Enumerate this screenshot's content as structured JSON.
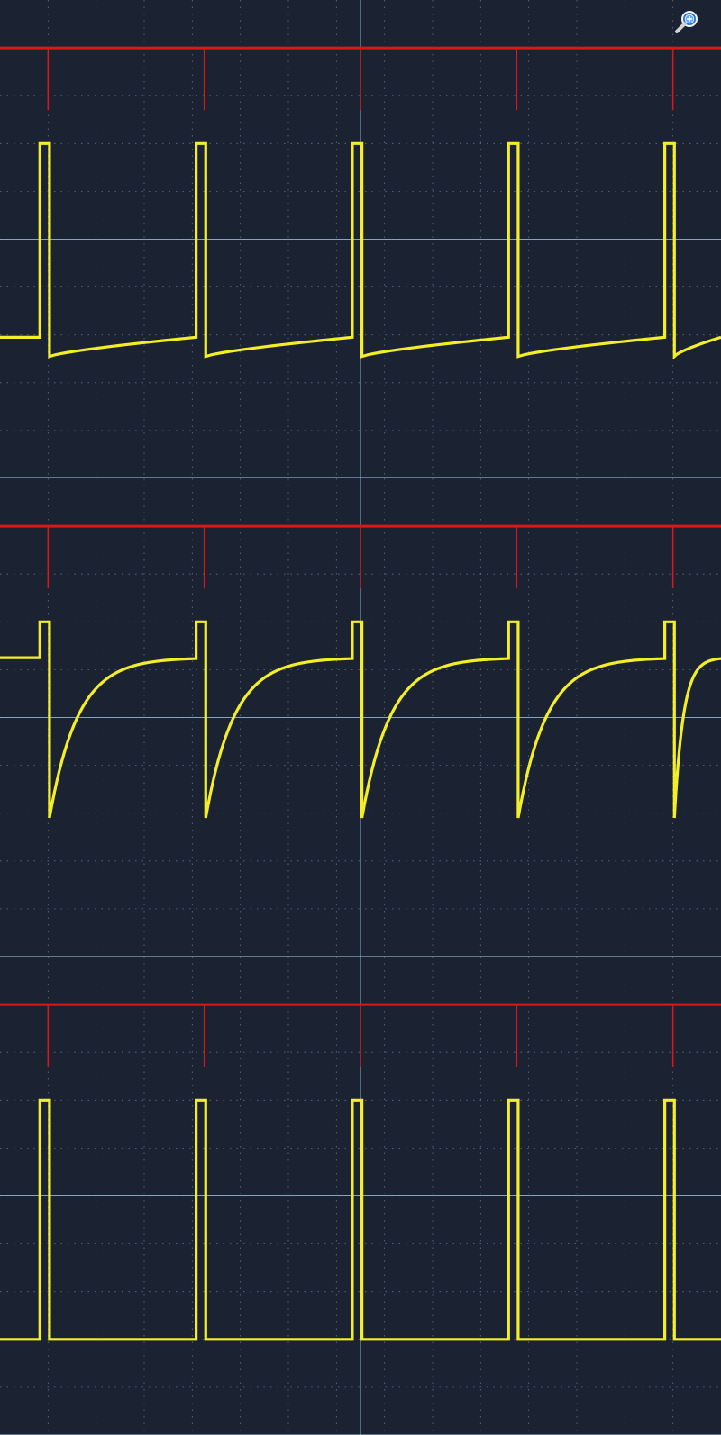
{
  "chart_data": [
    {
      "type": "line",
      "name": "panel-1",
      "x_divisions": 15,
      "y_divisions": 10,
      "grid": true,
      "colors": {
        "background": "#1b2333",
        "grid": "#8fb3cf",
        "red": "#e01515",
        "yellow": "#f4ee28"
      },
      "series": [
        {
          "color": "red",
          "baseline_div": 9.0,
          "pulses": [
            {
              "x": 1.0,
              "bottom": 7.7
            },
            {
              "x": 4.25,
              "bottom": 7.7
            },
            {
              "x": 7.5,
              "bottom": 7.7
            },
            {
              "x": 10.75,
              "bottom": 7.7
            },
            {
              "x": 14.0,
              "bottom": 7.7
            }
          ]
        },
        {
          "color": "yellow",
          "shape": "pulse-with-ramp",
          "period_div": 3.25,
          "pulse_starts": [
            0.83,
            4.08,
            7.33,
            10.58,
            13.83
          ],
          "pulse_width_div": 0.2,
          "high_div": 7.0,
          "drop_div": 2.55,
          "ramp_end_div": 2.95
        }
      ]
    },
    {
      "type": "line",
      "name": "panel-2",
      "x_divisions": 15,
      "y_divisions": 10,
      "grid": true,
      "colors": {
        "background": "#1b2333",
        "grid": "#8fb3cf",
        "red": "#e01515",
        "yellow": "#f4ee28"
      },
      "series": [
        {
          "color": "red",
          "baseline_div": 9.0,
          "pulses": [
            {
              "x": 1.0,
              "bottom": 7.7
            },
            {
              "x": 4.25,
              "bottom": 7.7
            },
            {
              "x": 7.5,
              "bottom": 7.7
            },
            {
              "x": 10.75,
              "bottom": 7.7
            },
            {
              "x": 14.0,
              "bottom": 7.7
            }
          ]
        },
        {
          "color": "yellow",
          "shape": "pulse-with-exponential-recovery",
          "period_div": 3.25,
          "pulse_starts": [
            0.83,
            4.08,
            7.33,
            10.58,
            13.83
          ],
          "pulse_width_div": 0.2,
          "high_div": 7.0,
          "drop_div": 2.9,
          "settle_div": 6.25
        }
      ]
    },
    {
      "type": "line",
      "name": "panel-3",
      "x_divisions": 15,
      "y_divisions": 10,
      "grid": true,
      "colors": {
        "background": "#1b2333",
        "grid": "#8fb3cf",
        "red": "#e01515",
        "yellow": "#f4ee28"
      },
      "series": [
        {
          "color": "red",
          "baseline_div": 9.0,
          "pulses": [
            {
              "x": 1.0,
              "bottom": 7.7
            },
            {
              "x": 4.25,
              "bottom": 7.7
            },
            {
              "x": 7.5,
              "bottom": 7.7
            },
            {
              "x": 10.75,
              "bottom": 7.7
            },
            {
              "x": 14.0,
              "bottom": 7.7
            }
          ]
        },
        {
          "color": "yellow",
          "shape": "pulse-flat",
          "period_div": 3.25,
          "pulse_starts": [
            0.83,
            4.08,
            7.33,
            10.58,
            13.83
          ],
          "pulse_width_div": 0.2,
          "high_div": 7.0,
          "low_div": 2.0
        }
      ]
    }
  ],
  "icons": {
    "zoom": "zoom-magnifier-icon"
  }
}
